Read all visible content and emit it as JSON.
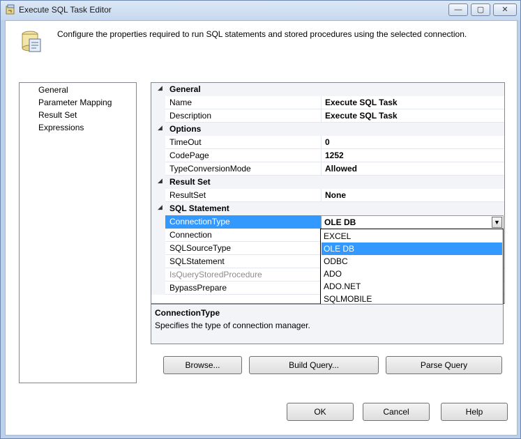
{
  "window": {
    "title": "Execute SQL Task Editor",
    "controls": {
      "minimize": "—",
      "maximize": "▢",
      "close": "✕"
    }
  },
  "header": {
    "description": "Configure the properties required to run SQL statements and stored procedures using the selected connection."
  },
  "nav": {
    "items": [
      "General",
      "Parameter Mapping",
      "Result Set",
      "Expressions"
    ]
  },
  "grid": {
    "categories": {
      "general": "General",
      "options": "Options",
      "result_set": "Result Set",
      "sql_statement": "SQL Statement"
    },
    "rows": {
      "name": {
        "label": "Name",
        "value": "Execute SQL Task"
      },
      "description": {
        "label": "Description",
        "value": "Execute SQL Task"
      },
      "timeout": {
        "label": "TimeOut",
        "value": "0"
      },
      "codepage": {
        "label": "CodePage",
        "value": "1252"
      },
      "typeconv": {
        "label": "TypeConversionMode",
        "value": "Allowed"
      },
      "resultset": {
        "label": "ResultSet",
        "value": "None"
      },
      "conntype": {
        "label": "ConnectionType",
        "value": "OLE DB"
      },
      "connection": {
        "label": "Connection",
        "value": ""
      },
      "sqlsourcetype": {
        "label": "SQLSourceType",
        "value": ""
      },
      "sqlstatement": {
        "label": "SQLStatement",
        "value": ""
      },
      "isquerysp": {
        "label": "IsQueryStoredProcedure",
        "value": ""
      },
      "bypassprepare": {
        "label": "BypassPrepare",
        "value": ""
      }
    },
    "collapse_glyph": "◢"
  },
  "dropdown": {
    "selected": "OLE DB",
    "arrow": "▼",
    "options": [
      "EXCEL",
      "OLE DB",
      "ODBC",
      "ADO",
      "ADO.NET",
      "SQLMOBILE"
    ]
  },
  "description_panel": {
    "title": "ConnectionType",
    "text": "Specifies the type of connection manager."
  },
  "buttons": {
    "browse": "Browse...",
    "build_query": "Build Query...",
    "parse_query": "Parse Query",
    "ok": "OK",
    "cancel": "Cancel",
    "help": "Help"
  },
  "colors": {
    "selection": "#3399ff",
    "category_bg": "#f2f4f8",
    "window_frame": "#c6d8ef"
  }
}
